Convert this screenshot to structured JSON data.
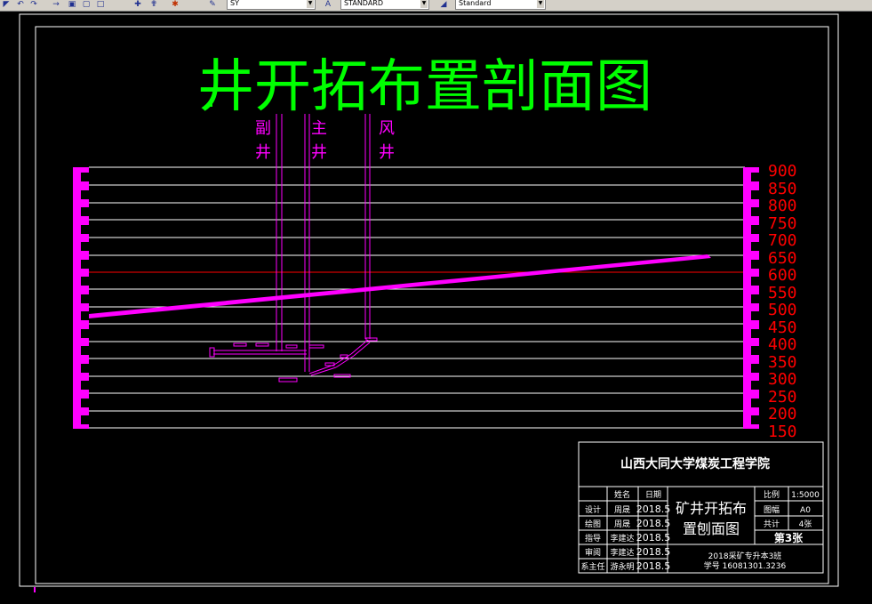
{
  "toolbar": {
    "icons": [
      "zoom-icon",
      "undo-icon",
      "redo-icon",
      "matchprop-icon",
      "properties-icon",
      "help-icon",
      "pan-icon",
      "paint-icon",
      "pen-icon"
    ],
    "layer_value": "SY",
    "textstyle_value": "STANDARD",
    "dimstyle_value": "Standard"
  },
  "drawing": {
    "title": "井开拓布置剖面图",
    "shaft_labels": [
      {
        "line1": "副",
        "line2": "井"
      },
      {
        "line1": "主",
        "line2": "井"
      },
      {
        "line1": "风",
        "line2": "井"
      }
    ],
    "elevations": [
      "900",
      "850",
      "800",
      "750",
      "700",
      "650",
      "600",
      "550",
      "500",
      "450",
      "400",
      "350",
      "300",
      "250",
      "200",
      "150"
    ],
    "colors": {
      "title": "#00ff00",
      "shaft": "#ff00ff",
      "elevation_text": "#ff0000",
      "grid": "#ffffff",
      "reference_line": "#ff0000"
    }
  },
  "title_block": {
    "school": "山西大同大学煤炭工程学院",
    "header_name": "姓名",
    "header_date": "日期",
    "rows": [
      {
        "role": "设计",
        "name": "周晟",
        "date": "2018.5"
      },
      {
        "role": "绘图",
        "name": "周晟",
        "date": "2018.5"
      },
      {
        "role": "指导",
        "name": "李建达",
        "date": "2018.5"
      },
      {
        "role": "审阅",
        "name": "李建达",
        "date": "2018.5"
      },
      {
        "role": "系主任",
        "name": "游永明",
        "date": "2018.5"
      }
    ],
    "drawing_name_line1": "矿井开拓布",
    "drawing_name_line2": "置刨面图",
    "scale_label": "比例",
    "scale_value": "1:5000",
    "size_label": "图幅",
    "size_value": "A0",
    "count_label": "共计",
    "count_value": "4张",
    "sheet_label": "第3张",
    "class_info": "2018采矿专升本3班",
    "student_id": "学号 16081301.3236"
  }
}
